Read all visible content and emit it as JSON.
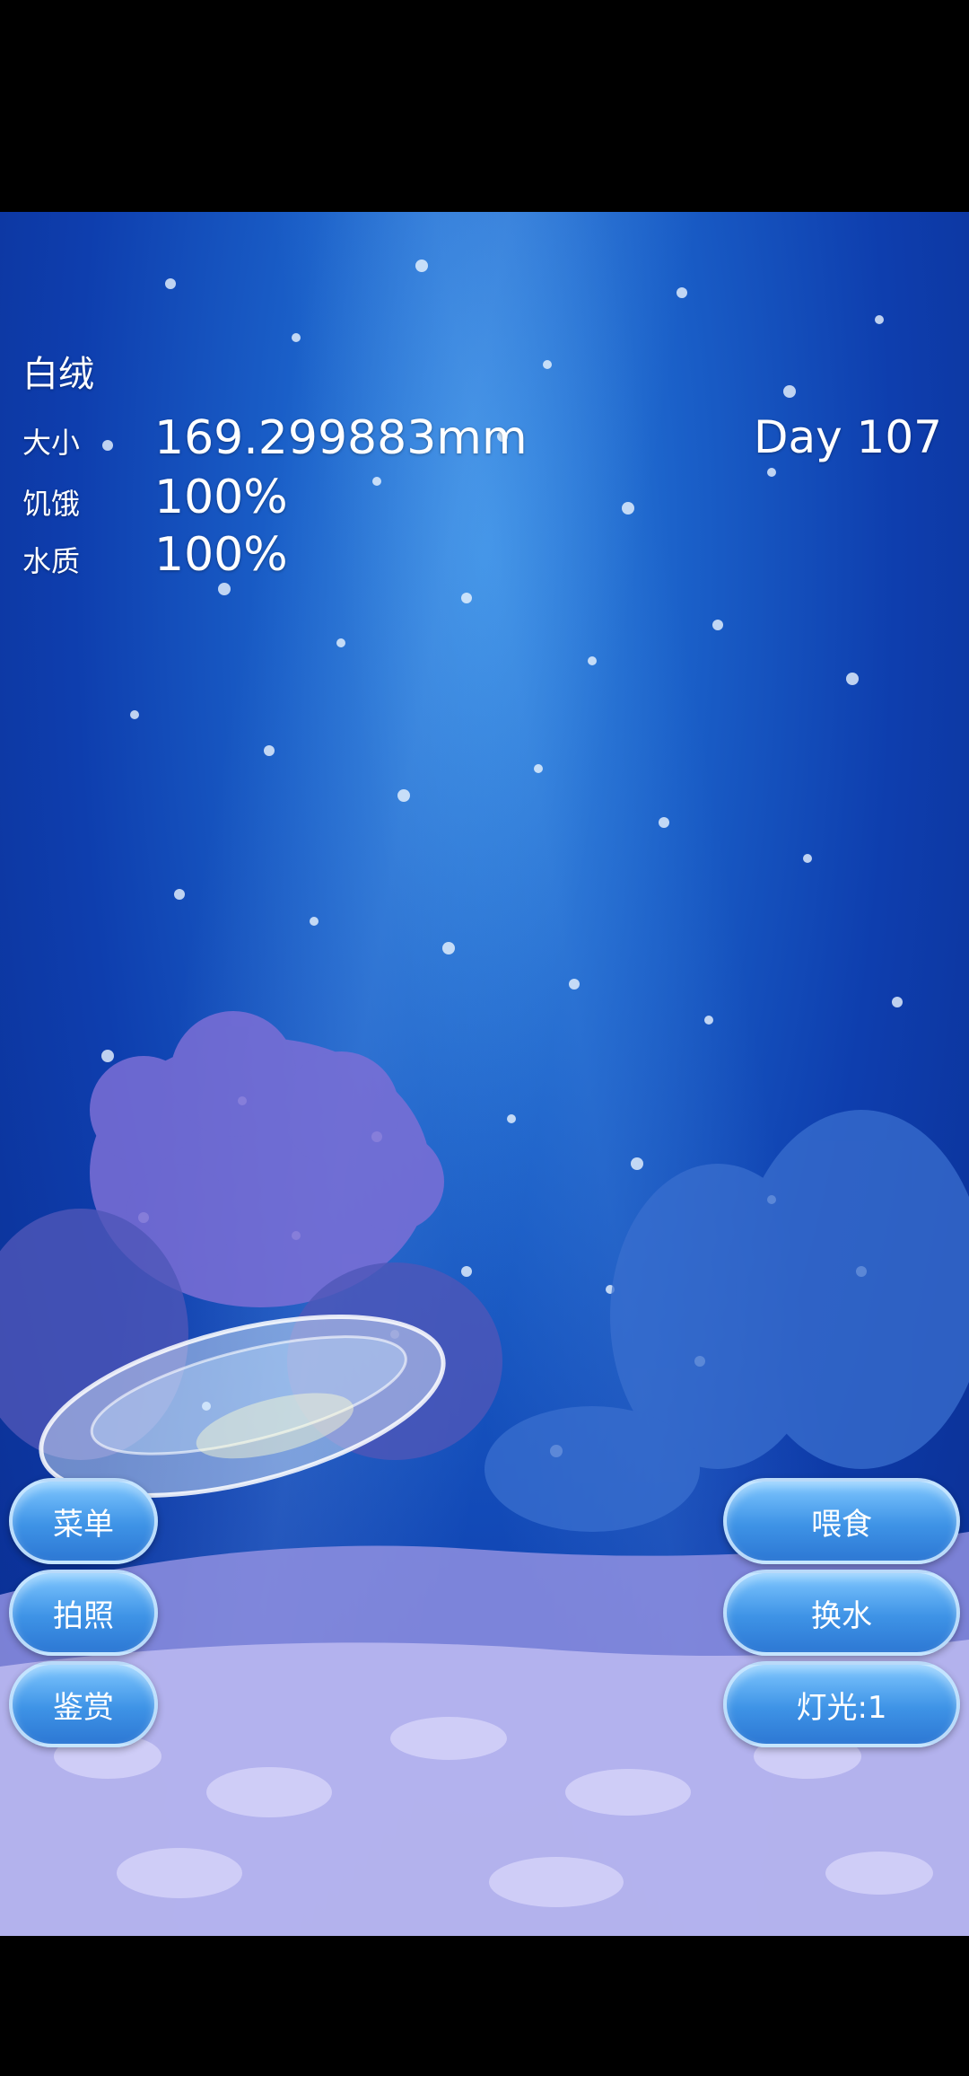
{
  "status": {
    "name": "白绒",
    "size_label": "大小",
    "size_value": "169.299883mm",
    "hunger_label": "饥饿",
    "hunger_value": "100%",
    "water_label": "水质",
    "water_value": "100%",
    "day": "Day 107"
  },
  "left_buttons": {
    "menu": "菜单",
    "photo": "拍照",
    "appreciate": "鉴赏"
  },
  "right_buttons": {
    "feed": "喂食",
    "change_water": "换水",
    "light": "灯光:1"
  },
  "colors": {
    "water_top": "#2f86e0",
    "water_bottom": "#0a2c8e",
    "button": "#3e93e6",
    "coral": "#7c6fd6",
    "sand": "#b9b7ef"
  }
}
